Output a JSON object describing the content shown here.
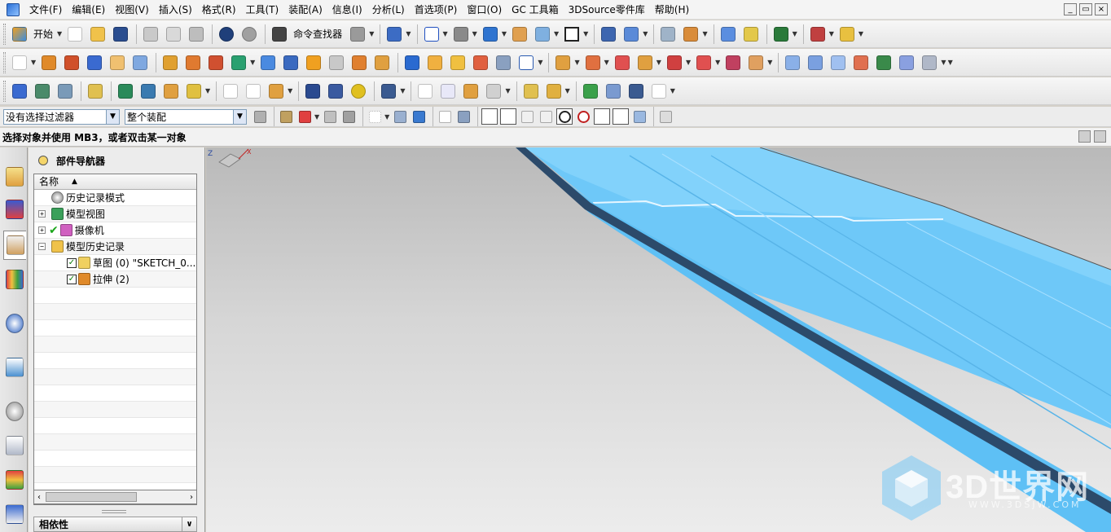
{
  "menu": {
    "items": [
      "文件(F)",
      "编辑(E)",
      "视图(V)",
      "插入(S)",
      "格式(R)",
      "工具(T)",
      "装配(A)",
      "信息(I)",
      "分析(L)",
      "首选项(P)",
      "窗口(O)",
      "GC 工具箱",
      "3DSource零件库",
      "帮助(H)"
    ]
  },
  "window_controls": {
    "minimize": "_",
    "restore": "▭",
    "close": "×"
  },
  "toolbar": {
    "start_label": "开始",
    "command_finder_label": "命令查找器"
  },
  "selection": {
    "filter_value": "没有选择过滤器",
    "scope_value": "整个装配"
  },
  "status": {
    "prompt": "选择对象并使用 MB3，或者双击某一对象"
  },
  "navigator": {
    "title": "部件导航器",
    "column_name": "名称",
    "rows": [
      {
        "label": "历史记录模式",
        "icon": "clock-icon",
        "indent": 0,
        "expander": "",
        "check": ""
      },
      {
        "label": "模型视图",
        "icon": "model-views-icon",
        "indent": 0,
        "expander": "+",
        "check": ""
      },
      {
        "label": "摄像机",
        "icon": "camera-icon",
        "indent": 0,
        "expander": "+",
        "check": "green"
      },
      {
        "label": "模型历史记录",
        "icon": "folder-icon",
        "indent": 0,
        "expander": "−",
        "check": ""
      },
      {
        "label": "草图 (0) \"SKETCH_0...",
        "icon": "sketch-icon",
        "indent": 1,
        "expander": "",
        "check": "box"
      },
      {
        "label": "拉伸 (2)",
        "icon": "extrude-icon",
        "indent": 1,
        "expander": "",
        "check": "box"
      }
    ],
    "dependency_title": "相依性"
  },
  "watermark": {
    "brand": "3D世界网",
    "url": "WWW.3DSJW.COM"
  },
  "colors": {
    "model_face": "#6ec8f8",
    "model_edge": "#2c4a6a",
    "viewport_top": "#b9b9b9",
    "viewport_bottom": "#ececec"
  }
}
